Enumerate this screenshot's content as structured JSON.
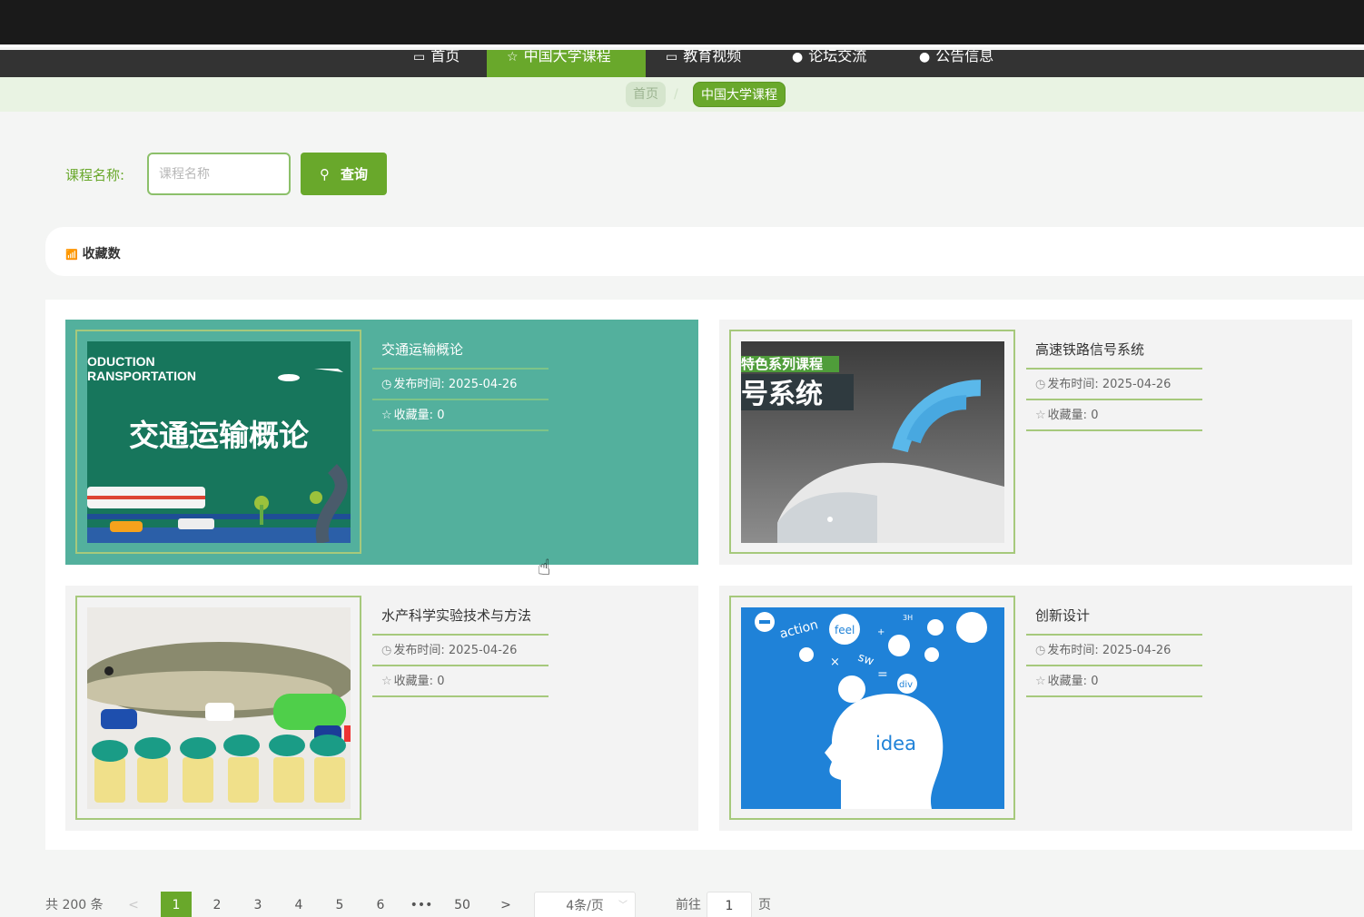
{
  "nav": {
    "items": [
      {
        "icon": "▭",
        "label": "首页"
      },
      {
        "icon": "☆",
        "label": "中国大学课程"
      },
      {
        "icon": "▭",
        "label": "教育视频"
      },
      {
        "icon": "●",
        "label": "论坛交流"
      },
      {
        "icon": "●",
        "label": "公告信息"
      }
    ]
  },
  "breadcrumb": {
    "home": "首页",
    "separator": "/",
    "current": "中国大学课程"
  },
  "search": {
    "label": "课程名称:",
    "placeholder": "课程名称",
    "button_icon": "⚲",
    "button_label": "查询"
  },
  "sort": {
    "icon": "📶",
    "label": "收藏数"
  },
  "courses": [
    {
      "title": "交通运输概论",
      "publish_label": "发布时间:",
      "publish_date": "2025-04-26",
      "fav_label": "收藏量:",
      "fav_count": "0",
      "image_text": {
        "line1": "ODUCTION",
        "line2": "RANSPORTATION",
        "main": "交通运输概论"
      }
    },
    {
      "title": "高速铁路信号系统",
      "publish_label": "发布时间:",
      "publish_date": "2025-04-26",
      "fav_label": "收藏量:",
      "fav_count": "0",
      "image_text": {
        "tag": "特色系列课程",
        "main": "号系统"
      }
    },
    {
      "title": "水产科学实验技术与方法",
      "publish_label": "发布时间:",
      "publish_date": "2025-04-26",
      "fav_label": "收藏量:",
      "fav_count": "0"
    },
    {
      "title": "创新设计",
      "publish_label": "发布时间:",
      "publish_date": "2025-04-26",
      "fav_label": "收藏量:",
      "fav_count": "0",
      "image_text": {
        "w1": "action",
        "w2": "feel",
        "w3": "sw",
        "w4": "div",
        "w5": "idea",
        "w6": "3H"
      }
    }
  ],
  "pagination": {
    "total": "共 200 条",
    "prev": "<",
    "next": ">",
    "pages": [
      "1",
      "2",
      "3",
      "4",
      "5",
      "6",
      "•••",
      "50"
    ],
    "page_size": "4条/页",
    "goto_label": "前往",
    "goto_value": "1",
    "goto_suffix": "页"
  },
  "colors": {
    "accent": "#69a82b",
    "hover_card": "#53b09d",
    "border": "#a6c97c"
  }
}
